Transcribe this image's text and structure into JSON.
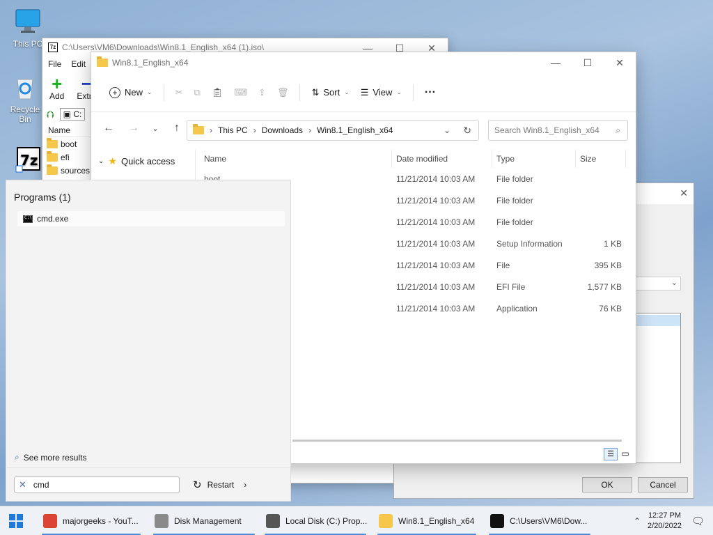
{
  "desktop": {
    "icons": [
      {
        "label": "This PC",
        "icon": "computer-icon"
      },
      {
        "label": "Recycle Bin",
        "icon": "recycle-bin-icon"
      },
      {
        "label": "",
        "icon": "7zip-shortcut-icon"
      }
    ]
  },
  "win7z": {
    "title": "C:\\Users\\VM6\\Downloads\\Win8.1_English_x64 (1).iso\\",
    "menu": [
      "File",
      "Edit"
    ],
    "toolbar": {
      "add_label": "Add",
      "extract_label": "Extra"
    },
    "address_partial": "C:",
    "header_name": "Name",
    "items": [
      "boot",
      "efi",
      "sources"
    ]
  },
  "properties": {
    "ok_label": "OK",
    "cancel_label": "Cancel"
  },
  "explorer": {
    "title": "Win8.1_English_x64",
    "commands": {
      "new_label": "New",
      "sort_label": "Sort",
      "view_label": "View",
      "more_label": "···"
    },
    "breadcrumb": [
      "This PC",
      "Downloads",
      "Win8.1_English_x64"
    ],
    "search_placeholder": "Search Win8.1_English_x64",
    "nav": {
      "quick_access": "Quick access"
    },
    "columns": {
      "name": "Name",
      "date": "Date modified",
      "type": "Type",
      "size": "Size"
    },
    "rows": [
      {
        "name": "boot",
        "date": "11/21/2014 10:03 AM",
        "type": "File folder",
        "size": ""
      },
      {
        "name": "",
        "date": "11/21/2014 10:03 AM",
        "type": "File folder",
        "size": ""
      },
      {
        "name": "",
        "date": "11/21/2014 10:03 AM",
        "type": "File folder",
        "size": ""
      },
      {
        "name": "",
        "date": "11/21/2014 10:03 AM",
        "type": "Setup Information",
        "size": "1 KB"
      },
      {
        "name": "",
        "date": "11/21/2014 10:03 AM",
        "type": "File",
        "size": "395 KB"
      },
      {
        "name": "",
        "date": "11/21/2014 10:03 AM",
        "type": "EFI File",
        "size": "1,577 KB"
      },
      {
        "name": "",
        "date": "11/21/2014 10:03 AM",
        "type": "Application",
        "size": "76 KB"
      }
    ]
  },
  "start_search": {
    "section": "Programs (1)",
    "program": "cmd.exe",
    "see_more": "See more results",
    "query": "cmd",
    "restart_label": "Restart"
  },
  "taskbar": {
    "items": [
      {
        "label": "majorgeeks - YouT...",
        "icon": "chrome-icon",
        "color": "#db4437"
      },
      {
        "label": "Disk Management",
        "icon": "disk-management-icon",
        "color": "#8a8a8a"
      },
      {
        "label": "Local Disk (C:) Prop...",
        "icon": "drive-properties-icon",
        "color": "#555555"
      },
      {
        "label": "Win8.1_English_x64",
        "icon": "folder-icon",
        "color": "#f5c84c"
      },
      {
        "label": "C:\\Users\\VM6\\Dow...",
        "icon": "7zip-icon",
        "color": "#111111"
      }
    ],
    "time": "12:27 PM",
    "date": "2/20/2022"
  }
}
